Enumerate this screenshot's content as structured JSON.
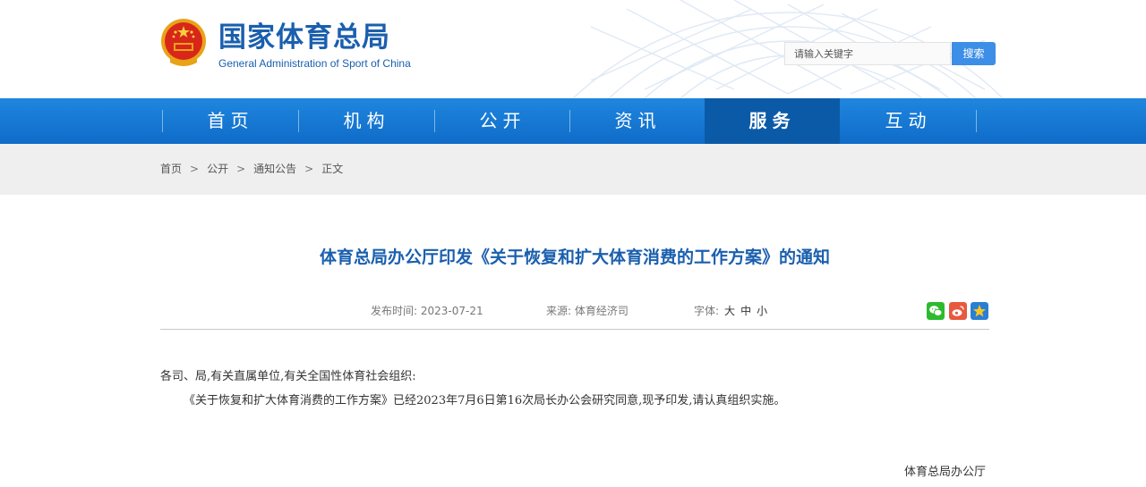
{
  "header": {
    "site_title": "国家体育总局",
    "site_subtitle": "General Administration of Sport of China",
    "search_placeholder": "请输入关键字",
    "search_button": "搜索"
  },
  "nav": {
    "items": [
      {
        "label": "首页"
      },
      {
        "label": "机构"
      },
      {
        "label": "公开"
      },
      {
        "label": "资讯"
      },
      {
        "label": "服务",
        "active": true
      },
      {
        "label": "互动"
      }
    ]
  },
  "breadcrumb": {
    "items": [
      "首页",
      "公开",
      "通知公告",
      "正文"
    ],
    "separator": ">"
  },
  "article": {
    "title": "体育总局办公厅印发《关于恢复和扩大体育消费的工作方案》的通知",
    "publish_label": "发布时间:",
    "publish_date": "2023-07-21",
    "source_label": "来源:",
    "source": "体育经济司",
    "font_label": "字体:",
    "font_large": "大",
    "font_medium": "中",
    "font_small": "小",
    "share_icons": [
      "wechat-icon",
      "weibo-icon",
      "favorite-star-icon"
    ],
    "salutation": "各司、局,有关直属单位,有关全国性体育社会组织:",
    "paragraph": "《关于恢复和扩大体育消费的工作方案》已经2023年7月6日第16次局长办公会研究同意,现予印发,请认真组织实施。",
    "signature": "体育总局办公厅"
  },
  "colors": {
    "brand_blue": "#1a5fae",
    "nav_blue": "#1477d4",
    "nav_active": "#0b5aa8",
    "search_button": "#3d8ee6",
    "breadcrumb_bg": "#efefef",
    "wechat": "#2dbb2d",
    "weibo": "#e8583f",
    "favorite": "#2a7fd4"
  }
}
